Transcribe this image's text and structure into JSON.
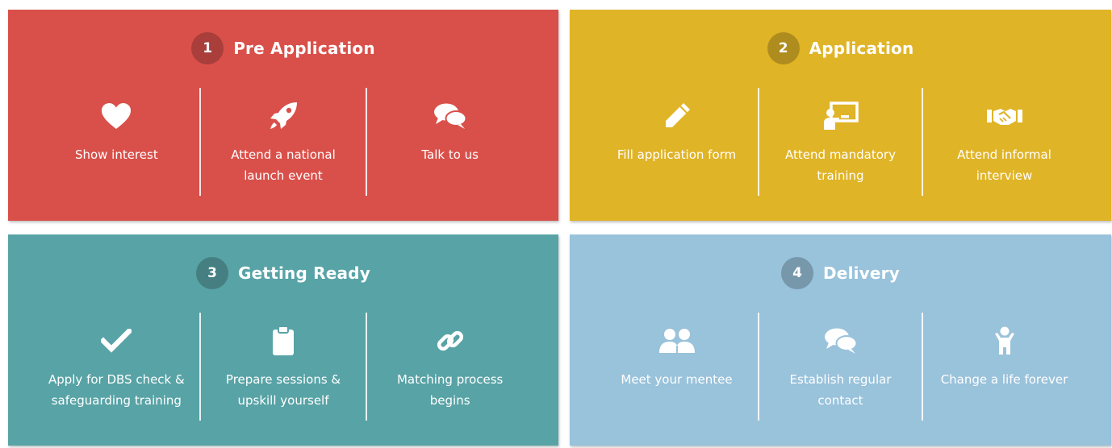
{
  "colors": {
    "panel1": "#D9504A",
    "panel2": "#E0B427",
    "panel3": "#58A3A6",
    "panel4": "#99C2DB"
  },
  "panels": [
    {
      "number": "1",
      "title": "Pre Application",
      "items": [
        {
          "icon": "heart-icon",
          "label": "Show interest"
        },
        {
          "icon": "rocket-icon",
          "label": "Attend a national\nlaunch event"
        },
        {
          "icon": "chat-bubbles-icon",
          "label": "Talk to us"
        }
      ]
    },
    {
      "number": "2",
      "title": "Application",
      "items": [
        {
          "icon": "pencil-icon",
          "label": "Fill application form"
        },
        {
          "icon": "presentation-icon",
          "label": "Attend mandatory\ntraining"
        },
        {
          "icon": "handshake-icon",
          "label": "Attend informal\ninterview"
        }
      ]
    },
    {
      "number": "3",
      "title": "Getting Ready",
      "items": [
        {
          "icon": "checkmark-icon",
          "label": "Apply for DBS check &\nsafeguarding training"
        },
        {
          "icon": "clipboard-icon",
          "label": "Prepare sessions &\nupskill yourself"
        },
        {
          "icon": "link-icon",
          "label": "Matching process\nbegins"
        }
      ]
    },
    {
      "number": "4",
      "title": "Delivery",
      "items": [
        {
          "icon": "people-icon",
          "label": "Meet your mentee"
        },
        {
          "icon": "chat-bubbles-icon",
          "label": "Establish regular\ncontact"
        },
        {
          "icon": "child-icon",
          "label": "Change a life forever"
        }
      ]
    }
  ]
}
